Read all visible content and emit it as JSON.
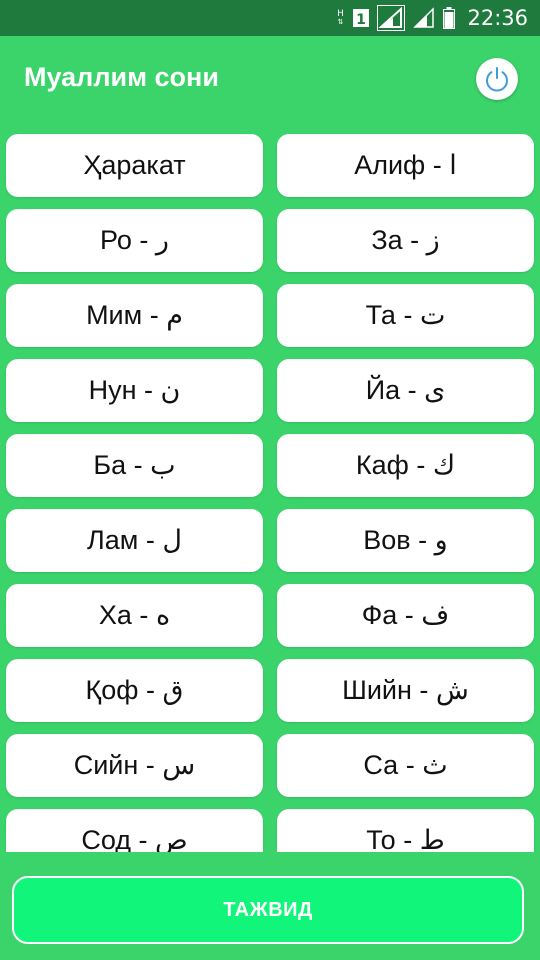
{
  "status_bar": {
    "network_badge": "H",
    "sim_label": "1",
    "time": "22:36"
  },
  "app_bar": {
    "title": "Муаллим сони",
    "power_icon": "power-icon"
  },
  "letters": [
    {
      "label": "Ҳаракат"
    },
    {
      "label": "Алиф - ا"
    },
    {
      "label": "Ро - ر"
    },
    {
      "label": "За - ز"
    },
    {
      "label": "Мим - م"
    },
    {
      "label": "Та - ت"
    },
    {
      "label": "Нун - ن"
    },
    {
      "label": "Йа - ى"
    },
    {
      "label": "Ба - ب"
    },
    {
      "label": "Каф - ك"
    },
    {
      "label": "Лам - ل"
    },
    {
      "label": "Вов - و"
    },
    {
      "label": "Ха - ه"
    },
    {
      "label": "Фа - ف"
    },
    {
      "label": "Қоф - ق"
    },
    {
      "label": "Шийн - ش"
    },
    {
      "label": "Сийн - س"
    },
    {
      "label": "Са - ث"
    },
    {
      "label": "Сод - ص"
    },
    {
      "label": "То - ط"
    }
  ],
  "bottom": {
    "button_label": "ТАЖВИД"
  },
  "colors": {
    "background": "#3ad46b",
    "status_bar": "#1e7a3d",
    "button_fill": "#10f57a",
    "power_icon": "#3a9fd8"
  }
}
